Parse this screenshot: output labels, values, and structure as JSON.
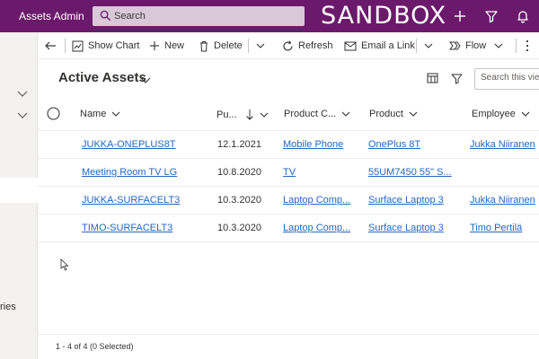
{
  "app": {
    "title": "Assets Admin",
    "search_placeholder": "Search",
    "environment_label": "SANDBOX",
    "brand_color": "#6b1a6b"
  },
  "nav": {
    "partial_label": "ries"
  },
  "commands": {
    "show_chart": "Show Chart",
    "new": "New",
    "delete": "Delete",
    "refresh": "Refresh",
    "email_link": "Email a Link",
    "flow": "Flow"
  },
  "view": {
    "title": "Active Assets",
    "search_placeholder": "Search this view"
  },
  "columns": {
    "name": "Name",
    "purchase": "Pu...",
    "product_category": "Product C...",
    "product": "Product",
    "employee": "Employee"
  },
  "rows": [
    {
      "name": "JUKKA-ONEPLUS8T",
      "purchase": "12.1.2021",
      "category": "Mobile Phone",
      "product": "OnePlus 8T",
      "employee": "Jukka Niiranen"
    },
    {
      "name": "Meeting Room TV LG",
      "purchase": "10.8.2020",
      "category": "TV",
      "product": "55UM7450 55\" S...",
      "employee": ""
    },
    {
      "name": "JUKKA-SURFACELT3",
      "purchase": "10.3.2020",
      "category": "Laptop Comp...",
      "product": "Surface Laptop 3",
      "employee": "Jukka Niiranen"
    },
    {
      "name": "TIMO-SURFACELT3",
      "purchase": "10.3.2020",
      "category": "Laptop Comp...",
      "product": "Surface Laptop 3",
      "employee": "Timo Pertilä"
    }
  ],
  "footer": {
    "count_text": "1 - 4 of 4 (0 Selected)"
  },
  "icons": {
    "search": "search-icon",
    "plus": "plus-icon",
    "filter": "filter-icon",
    "bell": "bell-icon",
    "back": "back-arrow-icon",
    "chart": "chart-icon",
    "trash": "trash-icon",
    "refresh": "refresh-icon",
    "mail": "mail-icon",
    "flow": "flow-icon"
  }
}
